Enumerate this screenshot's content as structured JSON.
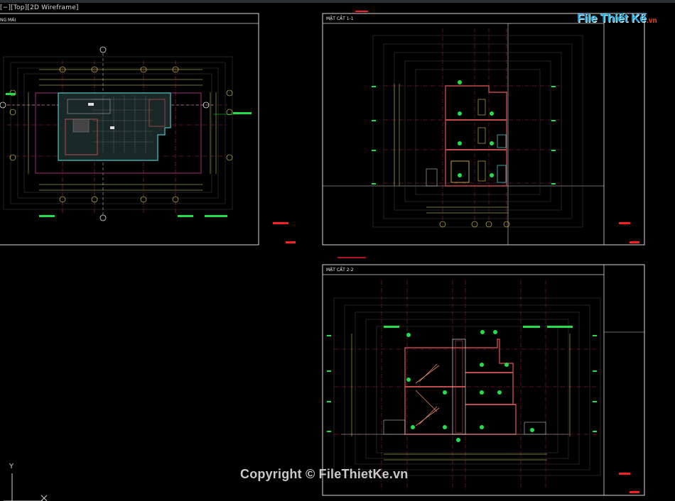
{
  "viewport": {
    "label": "[−][Top][2D Wireframe]"
  },
  "watermark": {
    "logo_main": "File Thiết Kế",
    "logo_suffix": ".vn",
    "copyright": "Copyright © FileThietKe.vn"
  },
  "ucs": {
    "y_label": "Y"
  },
  "sheets": [
    {
      "id": "plan",
      "title": "NG MÁI"
    },
    {
      "id": "section-1",
      "title": "MẶT CẮT 1-1"
    },
    {
      "id": "section-2",
      "title": "MẶT CẮT 2-2"
    }
  ],
  "colors": {
    "frame": "#d8d8d8",
    "dim": "#e6e65a",
    "grid_line": "#c0306a",
    "axis": "#aa2a4a",
    "cyan": "#4ec3c3",
    "green_mark": "#22e04a",
    "red_tag": "#ff2020",
    "text": "#f0f0f0",
    "logo_blue": "#19a8e6"
  }
}
